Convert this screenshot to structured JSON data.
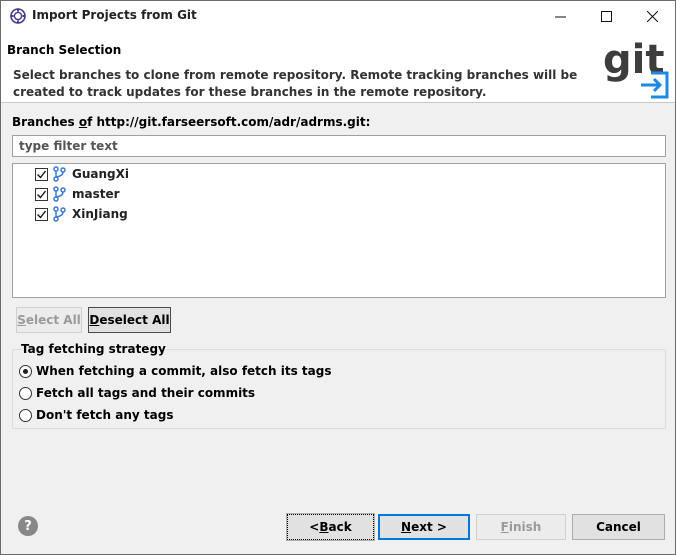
{
  "window": {
    "title": "Import Projects from Git"
  },
  "banner": {
    "heading": "Branch Selection",
    "description": "Select branches to clone from remote repository. Remote tracking branches will be created to track updates for these branches in the remote repository.",
    "logo_text": "git"
  },
  "branches": {
    "label_prefix": "Branches ",
    "label_underlined": "o",
    "label_rest": "f http://git.farseersoft.com/adr/adrms.git:",
    "filter_placeholder": "type filter text",
    "items": [
      {
        "name": "GuangXi",
        "checked": true
      },
      {
        "name": "master",
        "checked": true
      },
      {
        "name": "XinJiang",
        "checked": true
      }
    ],
    "select_all_mn": "S",
    "select_all_rest": "elect All",
    "deselect_all_mn": "D",
    "deselect_all_rest": "eselect All"
  },
  "tag_strategy": {
    "title": "Tag fetching strategy",
    "options": [
      {
        "label": "When fetching a commit, also fetch its tags",
        "selected": true
      },
      {
        "label": "Fetch all tags and their commits",
        "selected": false
      },
      {
        "label": "Don't fetch any tags",
        "selected": false
      }
    ]
  },
  "footer": {
    "help_icon": "?",
    "back_pre": "< ",
    "back_mn": "B",
    "back_rest": "ack",
    "next_mn": "N",
    "next_rest": "ext >",
    "finish_mn": "F",
    "finish_rest": "inish",
    "cancel_label": "Cancel"
  },
  "colors": {
    "accent": "#0078d7",
    "git_logo_text": "#3d3d3d",
    "git_logo_arrow": "#1e88e5",
    "branch_icon": "#3a7bd5"
  }
}
